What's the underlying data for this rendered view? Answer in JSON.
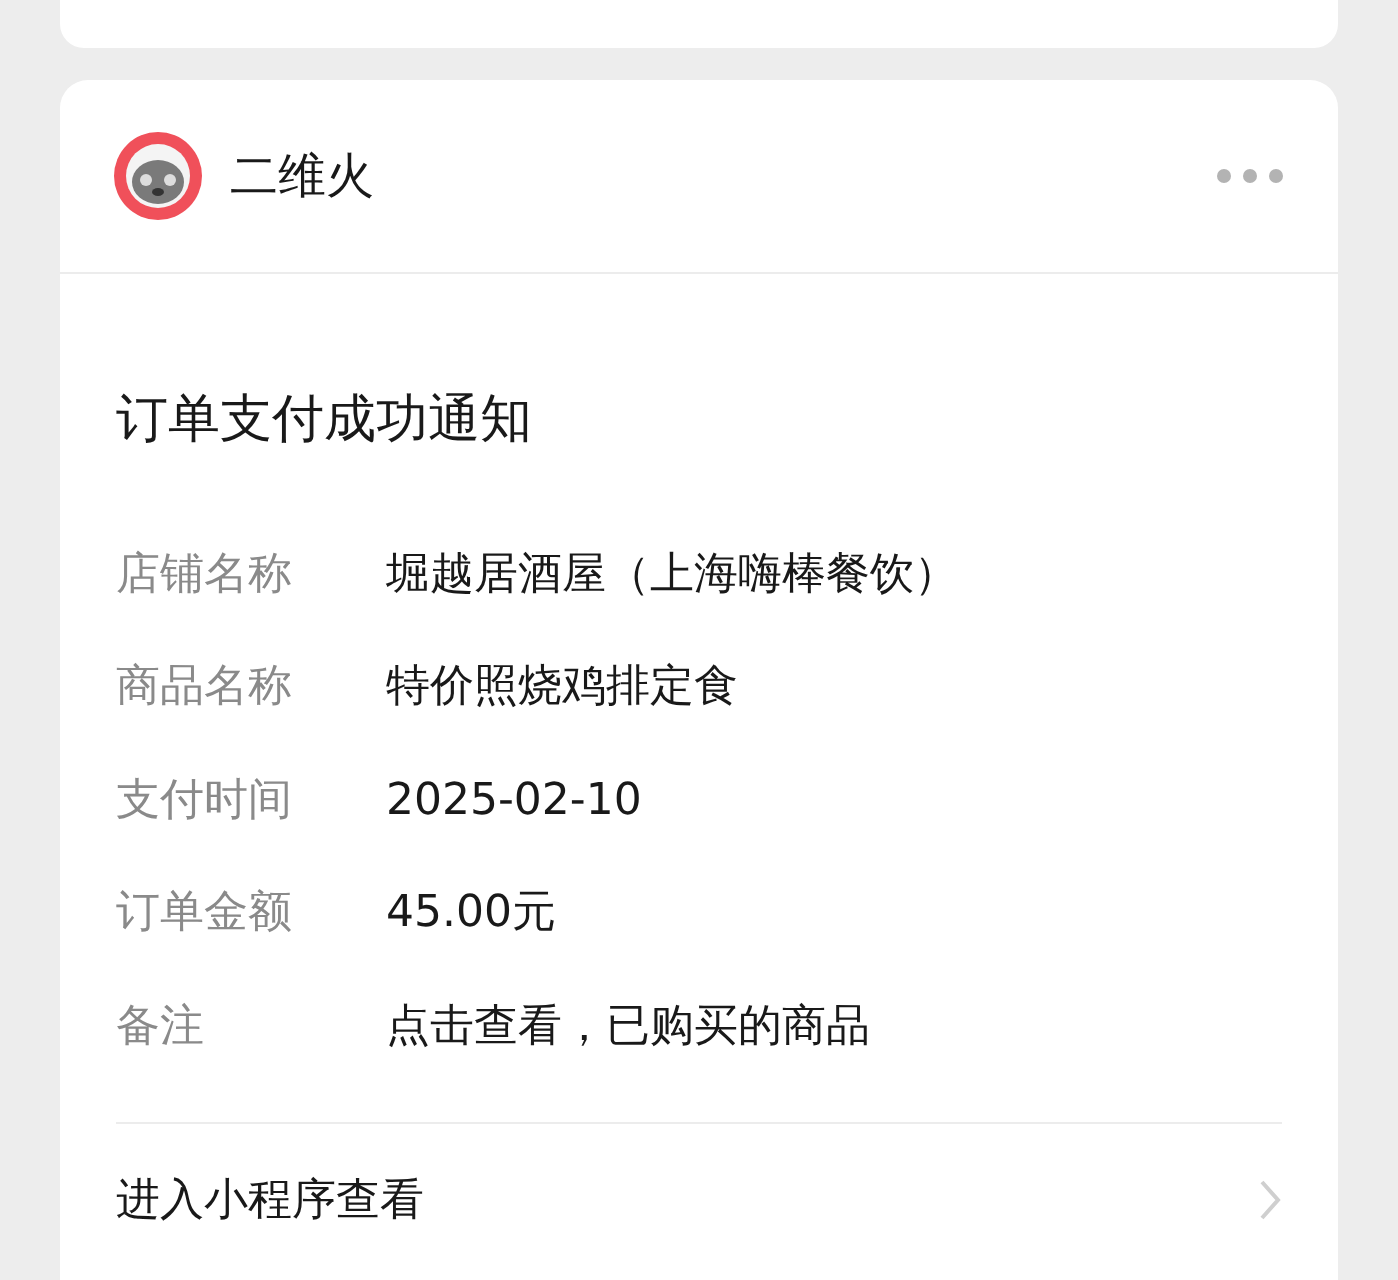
{
  "account": {
    "name": "二维火"
  },
  "message": {
    "title": "订单支付成功通知",
    "fields": [
      {
        "label": "店铺名称",
        "value": "堀越居酒屋（上海嗨棒餐饮）"
      },
      {
        "label": "商品名称",
        "value": "特价照烧鸡排定食"
      },
      {
        "label": "支付时间",
        "value": "2025-02-10"
      },
      {
        "label": "订单金额",
        "value": "45.00元"
      },
      {
        "label": "备注",
        "value": "点击查看，已购买的商品"
      }
    ],
    "link": "进入小程序查看"
  }
}
